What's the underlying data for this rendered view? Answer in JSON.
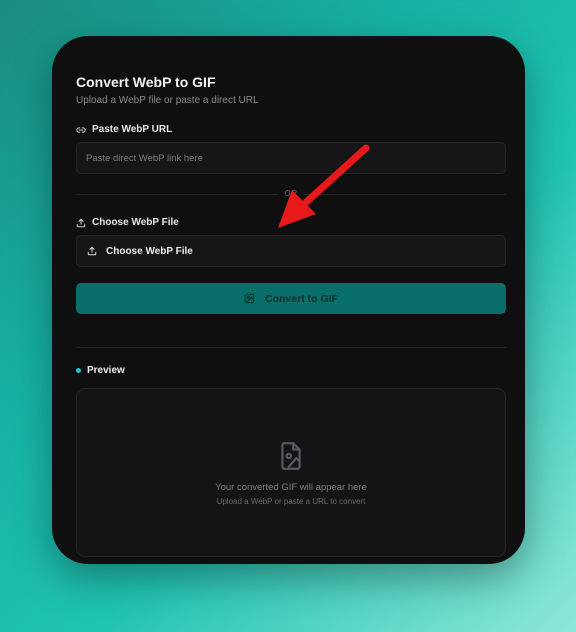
{
  "card": {
    "title": "Convert WebP to GIF",
    "subtitle": "Upload a WebP file or paste a direct URL"
  },
  "url_section": {
    "label": "Paste WebP URL",
    "icon": "link-icon",
    "placeholder": "Paste direct WebP link here",
    "value": ""
  },
  "separator": {
    "text": "OR"
  },
  "file_section": {
    "label": "Choose WebP File",
    "icon": "upload-icon",
    "button_label": "Choose WebP File"
  },
  "convert": {
    "label": "Convert to GIF",
    "icon": "image-icon"
  },
  "preview": {
    "label": "Preview",
    "icon": "file-image-icon",
    "empty_title": "Your converted GIF will appear here",
    "empty_subtitle": "Upload a WebP or paste a URL to convert"
  },
  "colors": {
    "accent": "#0a6e6a",
    "dot": "#21c3d6",
    "annotation_arrow": "#e8191a",
    "card_bg": "#0f0f10"
  }
}
